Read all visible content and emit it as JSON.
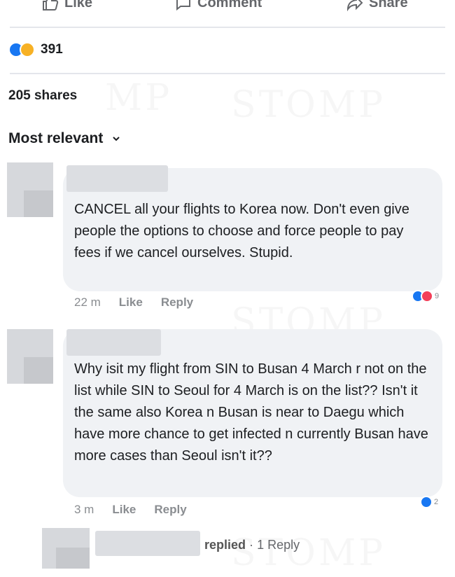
{
  "actions": {
    "like_label": "Like",
    "comment_label": "Comment",
    "share_label": "Share"
  },
  "reactions": {
    "count": "391",
    "types": [
      "like-reaction",
      "sad-reaction"
    ]
  },
  "shares_text": "205 shares",
  "sort_label": "Most relevant",
  "comments": [
    {
      "text": "CANCEL all your flights to Korea now. Don't even give people the options to choose and force people to pay fees if we cancel ourselves. Stupid.",
      "time": "22 m",
      "like_label": "Like",
      "reply_label": "Reply",
      "reaction_count": "9",
      "reaction_types": [
        "like-reaction",
        "love-reaction"
      ]
    },
    {
      "text": "Why isit my flight from SIN to Busan 4 March r not on the list while SIN to Seoul for 4 March is on the list?? Isn't it the same also Korea n Busan is near to Daegu which have more chance to get infected n currently Busan have more cases than Seoul isn't it??",
      "time": "3 m",
      "like_label": "Like",
      "reply_label": "Reply",
      "reaction_count": "2",
      "reaction_types": [
        "like-reaction"
      ]
    }
  ],
  "reply_thread": {
    "replied_label": "replied",
    "separator": "·",
    "reply_count": "1 Reply"
  },
  "colors": {
    "like_blue": "#1877f2",
    "love_red": "#f33e58",
    "sad_yellow": "#f7b125",
    "bubble_bg": "#f0f2f5",
    "meta_gray": "#8a8d91"
  }
}
